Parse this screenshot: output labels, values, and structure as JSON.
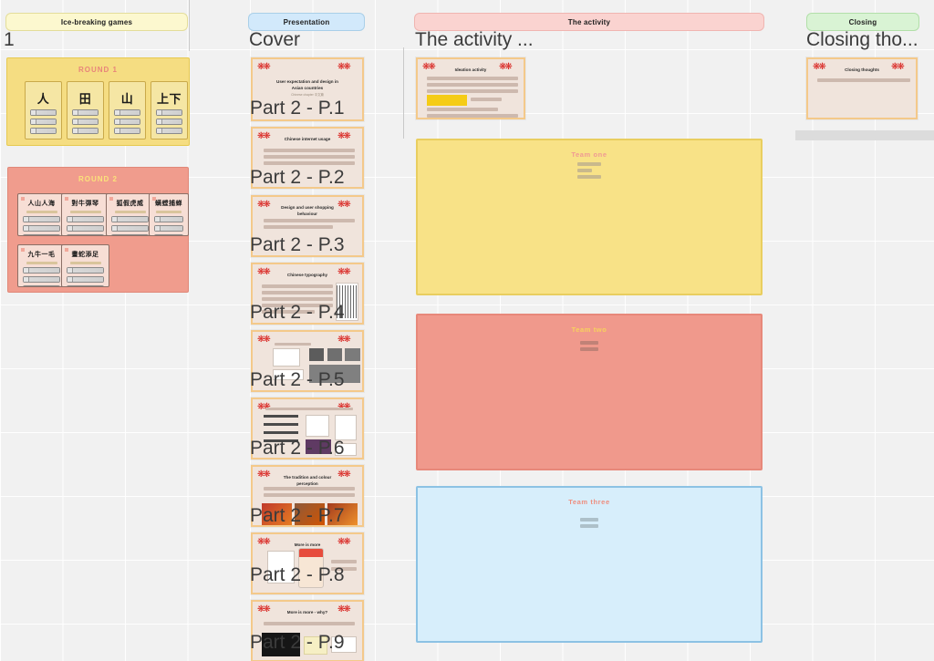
{
  "board": {
    "background_color": "#f1f1f1",
    "grid_color": "#d5d5d5"
  },
  "columns": [
    {
      "id": "ice-breaking",
      "chip_label": "Ice-breaking games",
      "chip_color": "#fcf8cf",
      "chip_border": "#e3dd9a",
      "title": "1"
    },
    {
      "id": "presentation",
      "chip_label": "Presentation",
      "chip_color": "#d2e9fb",
      "chip_border": "#a9cfe8",
      "title": "Cover"
    },
    {
      "id": "activity",
      "chip_label": "The activity",
      "chip_color": "#fad3d0",
      "chip_border": "#f0b5b1",
      "title": "The activity ..."
    },
    {
      "id": "closing",
      "chip_label": "Closing",
      "chip_color": "#d9f3d4",
      "chip_border": "#b2dfa9",
      "title": "Closing tho..."
    }
  ],
  "rounds": [
    {
      "id": "round-1",
      "label": "ROUND 1",
      "label_color": "#e8857a",
      "fill": "#f5dd82",
      "border": "#e6c94f",
      "cards": [
        {
          "glyph": "人",
          "bars": 3
        },
        {
          "glyph": "田",
          "bars": 3
        },
        {
          "glyph": "山",
          "bars": 3
        },
        {
          "glyph": "上下",
          "bars": 3
        }
      ]
    },
    {
      "id": "round-2",
      "label": "ROUND 2",
      "label_color": "#fbe27a",
      "fill": "#f09c8d",
      "border": "#e08878",
      "cards": [
        {
          "glyph": "人山人海",
          "bars": 3
        },
        {
          "glyph": "對牛彈琴",
          "bars": 3
        },
        {
          "glyph": "狐假虎威",
          "bars": 3
        },
        {
          "glyph": "螨螳捕蝉",
          "bars": 3
        },
        {
          "glyph": "九牛一毛",
          "bars": 3
        },
        {
          "glyph": "畫蛇添足",
          "bars": 3
        }
      ]
    }
  ],
  "presentation_slides": [
    {
      "overlay": "Part 2 - P.1",
      "title": "User expectation and design in Asian countries",
      "subtitle": "Chinese chapter 中文篇",
      "layout": "cover"
    },
    {
      "overlay": "Part 2 - P.2",
      "title": "Chinese internet usage",
      "layout": "lines3"
    },
    {
      "overlay": "Part 2 - P.3",
      "title": "Design and user shopping behaviour",
      "layout": "lines2"
    },
    {
      "overlay": "Part 2 - P.4",
      "title": "Chinese typography",
      "layout": "lines-image"
    },
    {
      "overlay": "Part 2 - P.5",
      "title": "",
      "layout": "collage-a"
    },
    {
      "overlay": "Part 2 - P.6",
      "title": "",
      "layout": "collage-b"
    },
    {
      "overlay": "Part 2 - P.7",
      "title": "The tradition and colour perception",
      "layout": "photo-row"
    },
    {
      "overlay": "Part 2 - P.8",
      "title": "More is more",
      "layout": "phones"
    },
    {
      "overlay": "Part 2 - P.9",
      "title": "More is more - why?",
      "layout": "charts"
    }
  ],
  "activity": {
    "slide": {
      "title": "Ideation activity",
      "layout": "ideation"
    },
    "teams": [
      {
        "label": "Team one",
        "label_color": "#ef9a93",
        "fill": "#f8e287",
        "border": "#e9ce5f",
        "lines": 3
      },
      {
        "label": "Team two",
        "label_color": "#f7d25c",
        "fill": "#f0998c",
        "border": "#e7887a",
        "lines": 2
      },
      {
        "label": "Team three",
        "label_color": "#ee8e7f",
        "fill": "#d7eefb",
        "border": "#8cc2e4",
        "lines": 2
      }
    ]
  },
  "closing": {
    "slide": {
      "title": "Closing thoughts",
      "layout": "closing"
    }
  }
}
